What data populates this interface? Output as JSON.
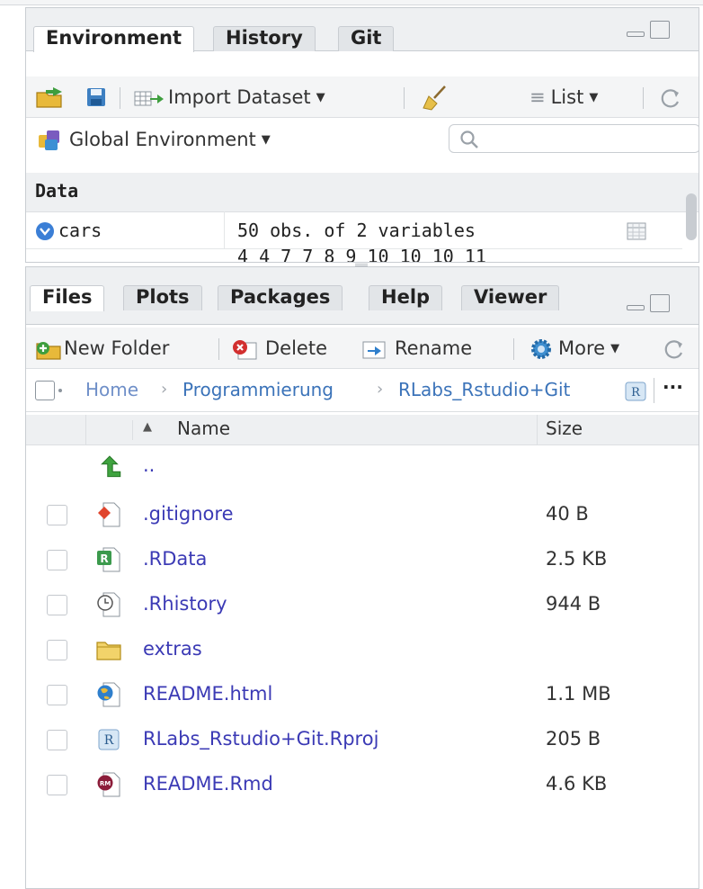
{
  "environment_pane": {
    "tabs": [
      {
        "label": "Environment",
        "active": true
      },
      {
        "label": "History",
        "active": false
      },
      {
        "label": "Git",
        "active": false
      }
    ],
    "toolbar": {
      "import_dataset_label": "Import Dataset",
      "view_mode_label": "List"
    },
    "env_selector_label": "Global Environment",
    "search": {
      "value": "",
      "placeholder": ""
    },
    "section_header": "Data",
    "rows": [
      {
        "name": "cars",
        "value": "50 obs. of 2 variables"
      }
    ],
    "partial_row_value": "4 4 7 7 8 9 10 10 10 11"
  },
  "files_pane": {
    "tabs": [
      {
        "label": "Files",
        "active": true
      },
      {
        "label": "Plots",
        "active": false
      },
      {
        "label": "Packages",
        "active": false
      },
      {
        "label": "Help",
        "active": false
      },
      {
        "label": "Viewer",
        "active": false
      }
    ],
    "toolbar": {
      "new_folder_label": "New Folder",
      "delete_label": "Delete",
      "rename_label": "Rename",
      "more_label": "More"
    },
    "breadcrumb": [
      "Home",
      "Programmierung",
      "RLabs_Rstudio+Git"
    ],
    "breadcrumb_more": "···",
    "columns": {
      "name": "Name",
      "size": "Size",
      "sort_glyph": "▲"
    },
    "parent_dir_label": "..",
    "files": [
      {
        "name": ".gitignore",
        "size": "40 B",
        "icon": "git-file-icon"
      },
      {
        "name": ".RData",
        "size": "2.5 KB",
        "icon": "rdata-file-icon"
      },
      {
        "name": ".Rhistory",
        "size": "944 B",
        "icon": "history-file-icon"
      },
      {
        "name": "extras",
        "size": "",
        "icon": "folder-icon"
      },
      {
        "name": "README.html",
        "size": "1.1 MB",
        "icon": "html-file-icon"
      },
      {
        "name": "RLabs_Rstudio+Git.Rproj",
        "size": "205 B",
        "icon": "rproj-file-icon"
      },
      {
        "name": "README.Rmd",
        "size": "4.6 KB",
        "icon": "rmd-file-icon"
      }
    ]
  },
  "colors": {
    "link": "#3b3ab5",
    "breadcrumb": "#3b73b9",
    "tabbar_bg": "#eef0f2",
    "border": "#c9cdd2"
  }
}
